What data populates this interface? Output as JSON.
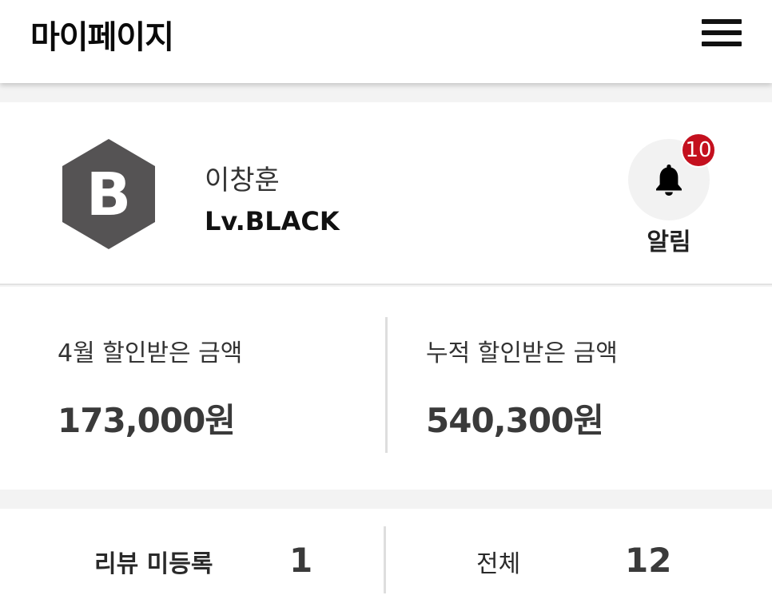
{
  "header": {
    "title": "마이페이지",
    "menu_icon": "hamburger-menu-icon"
  },
  "profile": {
    "badge_letter": "B",
    "badge_color": "#555354",
    "name": "이창훈",
    "level": "Lv.BLACK",
    "alarm": {
      "icon": "bell-icon",
      "count": "10",
      "label": "알림",
      "badge_color": "#c4101e"
    }
  },
  "discount": {
    "monthly_label": "4월 할인받은 금액",
    "monthly_value": "173,000원",
    "total_label": "누적 할인받은 금액",
    "total_value": "540,300원"
  },
  "review": {
    "unregistered_label": "리뷰 미등록",
    "unregistered_count": "1",
    "all_label": "전체",
    "all_count": "12"
  }
}
